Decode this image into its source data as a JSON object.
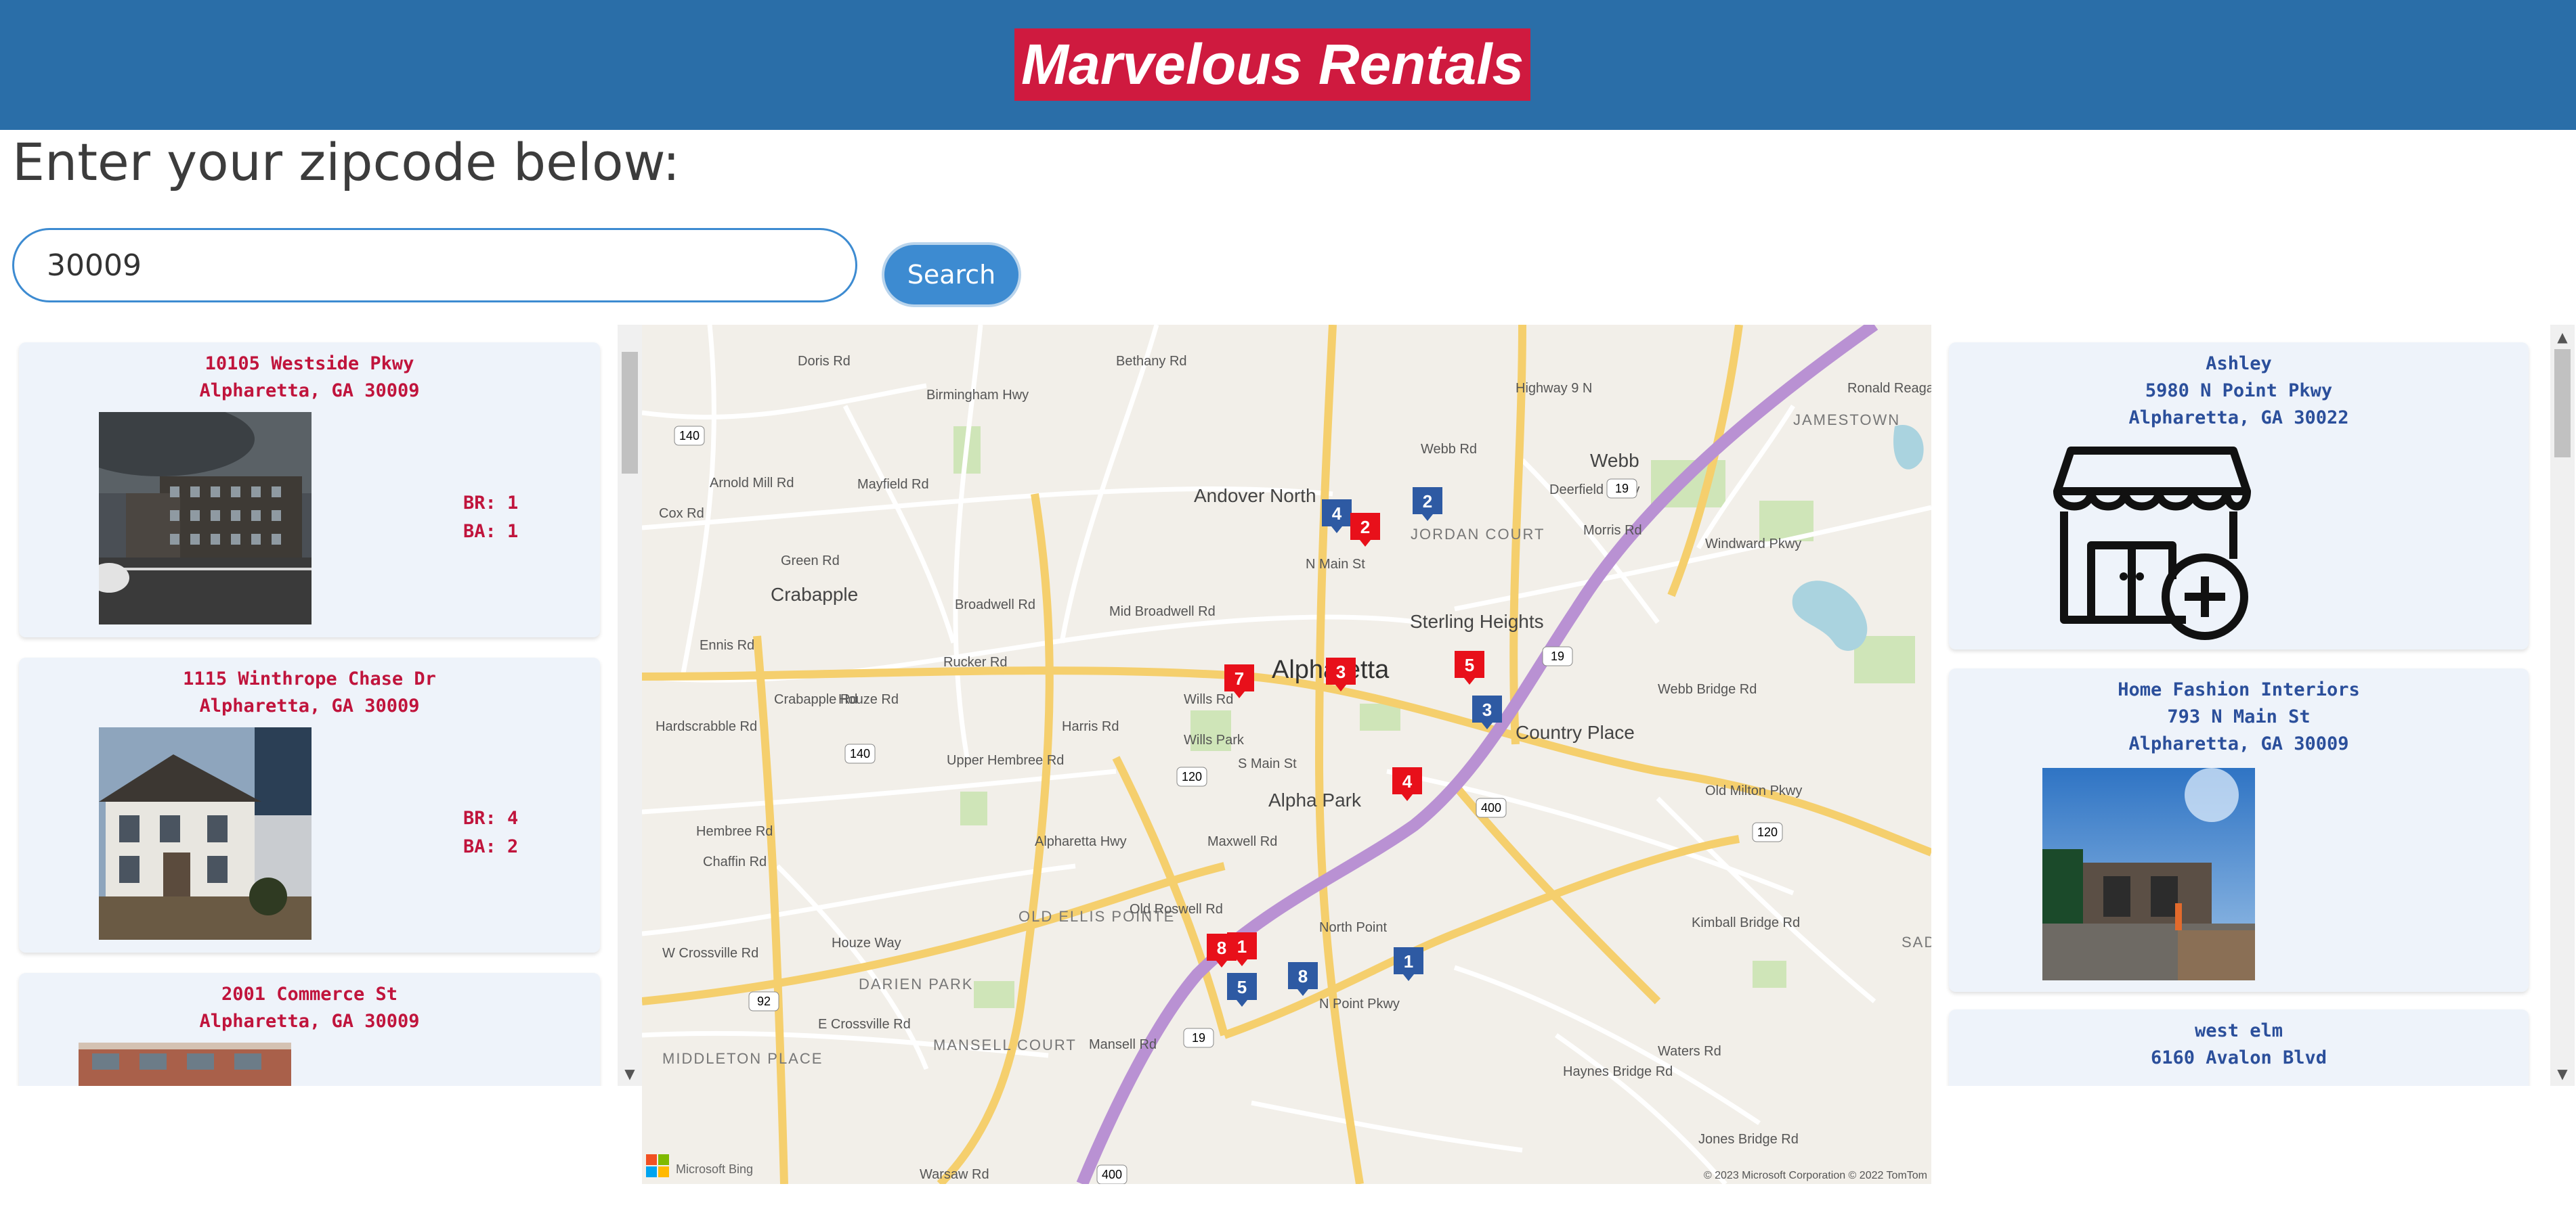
{
  "header": {
    "title": "Marvelous Rentals"
  },
  "search": {
    "prompt": "Enter your zipcode below:",
    "value": "30009",
    "button_label": "Search"
  },
  "listings": [
    {
      "street": "10105 Westside Pkwy",
      "city": "Alpharetta, GA 30009",
      "br": "BR: 1",
      "ba": "BA: 1"
    },
    {
      "street": "1115 Winthrope Chase Dr",
      "city": "Alpharetta, GA 30009",
      "br": "BR: 4",
      "ba": "BA: 2"
    },
    {
      "street": "2001 Commerce St",
      "city": "Alpharetta, GA 30009"
    }
  ],
  "businesses": [
    {
      "name": "Ashley",
      "street": "5980 N Point Pkwy",
      "city": "Alpharetta, GA 30022",
      "icon": "store-add-icon"
    },
    {
      "name": "Home Fashion Interiors",
      "street": "793 N Main St",
      "city": "Alpharetta, GA 30009"
    },
    {
      "name": "west elm",
      "street": "6160 Avalon Blvd"
    }
  ],
  "map": {
    "labels": {
      "alpharetta": "Alpharetta",
      "andover_north": "Andover North",
      "webb": "Webb",
      "jamestown": "JAMESTOWN",
      "crabapple": "Crabapple",
      "sterling_heights": "Sterling Heights",
      "jordan_court": "JORDAN COURT",
      "country_place": "Country Place",
      "alpha_park": "Alpha Park",
      "old_ellis_pointe": "OLD ELLIS POINTE",
      "darien_park": "DARIEN PARK",
      "mansell_court": "MANSELL COURT",
      "middleton_place": "MIDDLETON PLACE",
      "north_point": "North Point",
      "wills_park": "Wills Park",
      "sadd": "SADD BRID"
    },
    "roads": {
      "mayfield": "Mayfield Rd",
      "green": "Green Rd",
      "mid_broadwell": "Mid Broadwell Rd",
      "rucker": "Rucker Rd",
      "s_main": "S Main St",
      "old_milton": "Old Milton Pkwy",
      "n_point_pkwy": "N Point Pkwy",
      "webb_bridge": "Webb Bridge Rd",
      "kimball": "Kimball Bridge Rd",
      "windward": "Windward Pkwy",
      "haynes": "Haynes Bridge Rd",
      "mansell": "Mansell Rd",
      "warsaw": "Warsaw Rd",
      "houze": "Houze Way",
      "e_crossville": "E Crossville Rd",
      "w_crossville": "W Crossville Rd",
      "hembree": "Hembree Rd",
      "chaffin": "Chaffin Rd",
      "alpharetta_hwy": "Alpharetta Hwy",
      "maxwell": "Maxwell Rd",
      "broadwell": "Broadwell Rd",
      "ennis": "Ennis Rd",
      "cox": "Cox Rd",
      "arnold_mill": "Arnold Mill Rd",
      "doris": "Doris Rd",
      "bethany": "Bethany Rd",
      "birmingham": "Birmingham Hwy",
      "jones_bridge": "Jones Bridge Rd",
      "waters": "Waters Rd",
      "hardscrabble": "Hardscrabble Rd",
      "upper_hembree": "Upper Hembree Rd",
      "deerfield": "Deerfield Pkwy",
      "ronald_reagan": "Ronald Reagan Blvd",
      "harris": "Harris Rd",
      "wills": "Wills Rd",
      "old_roswell": "Old Roswell Rd",
      "morris": "Morris Rd",
      "n_main": "N Main St",
      "crabapple_rd": "Crabapple Rd",
      "houze_rd": "Houze Rd",
      "highway_9": "Highway 9 N",
      "webb_rd": "Webb Rd"
    },
    "shields": [
      "140",
      "140",
      "120",
      "19",
      "19",
      "400",
      "400",
      "120",
      "92",
      "19"
    ],
    "rental_pins": [
      "1",
      "2",
      "3",
      "4",
      "5",
      "7",
      "8"
    ],
    "business_pins": [
      "1",
      "2",
      "3",
      "4",
      "5",
      "8"
    ],
    "copyright": "© 2023 Microsoft Corporation © 2022 TomTom",
    "logo_text": "Microsoft Bing",
    "colors": {
      "rental_pin": "#e8101a",
      "business_pin": "#2e5aa3",
      "highway": "#b991d3"
    }
  },
  "colors": {
    "header": "#2a6ea8",
    "brand": "#cf1a3f",
    "accent": "#3d8bd1"
  }
}
